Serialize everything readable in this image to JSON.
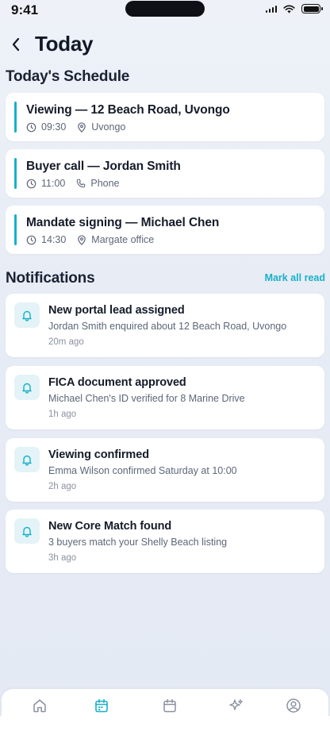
{
  "status_bar": {
    "time": "9:41"
  },
  "header": {
    "title": "Today"
  },
  "schedule": {
    "section_title": "Today's Schedule",
    "items": [
      {
        "title": "Viewing — 12 Beach Road, Uvongo",
        "time": "09:30",
        "location_icon": "location-pin-icon",
        "location": "Uvongo"
      },
      {
        "title": "Buyer call — Jordan Smith",
        "time": "11:00",
        "location_icon": "phone-icon",
        "location": "Phone"
      },
      {
        "title": "Mandate signing — Michael Chen",
        "time": "14:30",
        "location_icon": "location-pin-icon",
        "location": "Margate office"
      }
    ]
  },
  "notifications": {
    "section_title": "Notifications",
    "mark_all_label": "Mark all read",
    "items": [
      {
        "title": "New portal lead assigned",
        "body": "Jordan Smith enquired about 12 Beach Road, Uvongo",
        "time": "20m ago"
      },
      {
        "title": "FICA document approved",
        "body": "Michael Chen's ID verified for 8 Marine Drive",
        "time": "1h ago"
      },
      {
        "title": "Viewing confirmed",
        "body": "Emma Wilson confirmed Saturday at 10:00",
        "time": "2h ago"
      },
      {
        "title": "New Core Match found",
        "body": "3 buyers match your Shelly Beach listing",
        "time": "3h ago"
      }
    ]
  },
  "tab_bar": {
    "items": [
      {
        "icon": "home-icon",
        "active": false
      },
      {
        "icon": "calendar-icon",
        "active": true
      },
      {
        "icon": "calendar-icon",
        "active": false
      },
      {
        "icon": "sparkles-icon",
        "active": false
      },
      {
        "icon": "profile-icon",
        "active": false
      }
    ]
  },
  "colors": {
    "accent": "#17b1ca",
    "background": "#e7ecf5",
    "card": "#ffffff",
    "text": "#151b2a",
    "muted": "#5d6678"
  }
}
